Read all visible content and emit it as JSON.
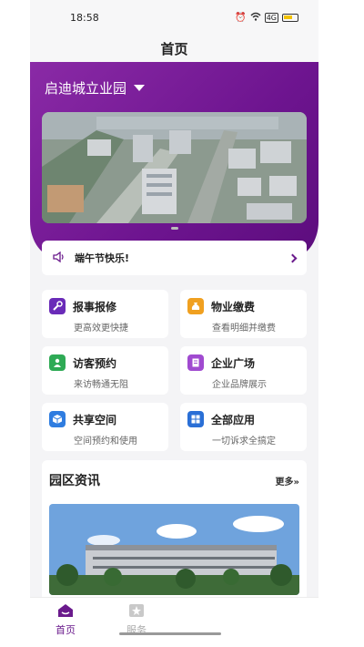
{
  "status": {
    "time": "18:58",
    "network": "4G"
  },
  "header": {
    "title": "首页"
  },
  "park": {
    "name": "启迪城立业园"
  },
  "notice": {
    "text": "端午节快乐!"
  },
  "services": [
    {
      "title": "报事报修",
      "subtitle": "更高效更快捷",
      "icon": "wrench-icon",
      "color": "#6a2bb8"
    },
    {
      "title": "物业缴费",
      "subtitle": "查看明细并缴费",
      "icon": "money-bag-icon",
      "color": "#f0a020"
    },
    {
      "title": "访客预约",
      "subtitle": "来访畅通无阻",
      "icon": "visitor-icon",
      "color": "#2eaa55"
    },
    {
      "title": "企业广场",
      "subtitle": "企业品牌展示",
      "icon": "building-icon",
      "color": "#a04ad0"
    },
    {
      "title": "共享空间",
      "subtitle": "空间预约和使用",
      "icon": "cube-icon",
      "color": "#2f7de0"
    },
    {
      "title": "全部应用",
      "subtitle": "一切诉求全搞定",
      "icon": "grid-icon",
      "color": "#2a6fd6"
    }
  ],
  "news": {
    "title": "园区资讯",
    "more": "更多»"
  },
  "tabs": [
    {
      "label": "首页",
      "icon": "home-icon"
    },
    {
      "label": "服务",
      "icon": "star-icon"
    }
  ],
  "colors": {
    "brand": "#6a1a8c",
    "background": "#f4f4f6"
  }
}
